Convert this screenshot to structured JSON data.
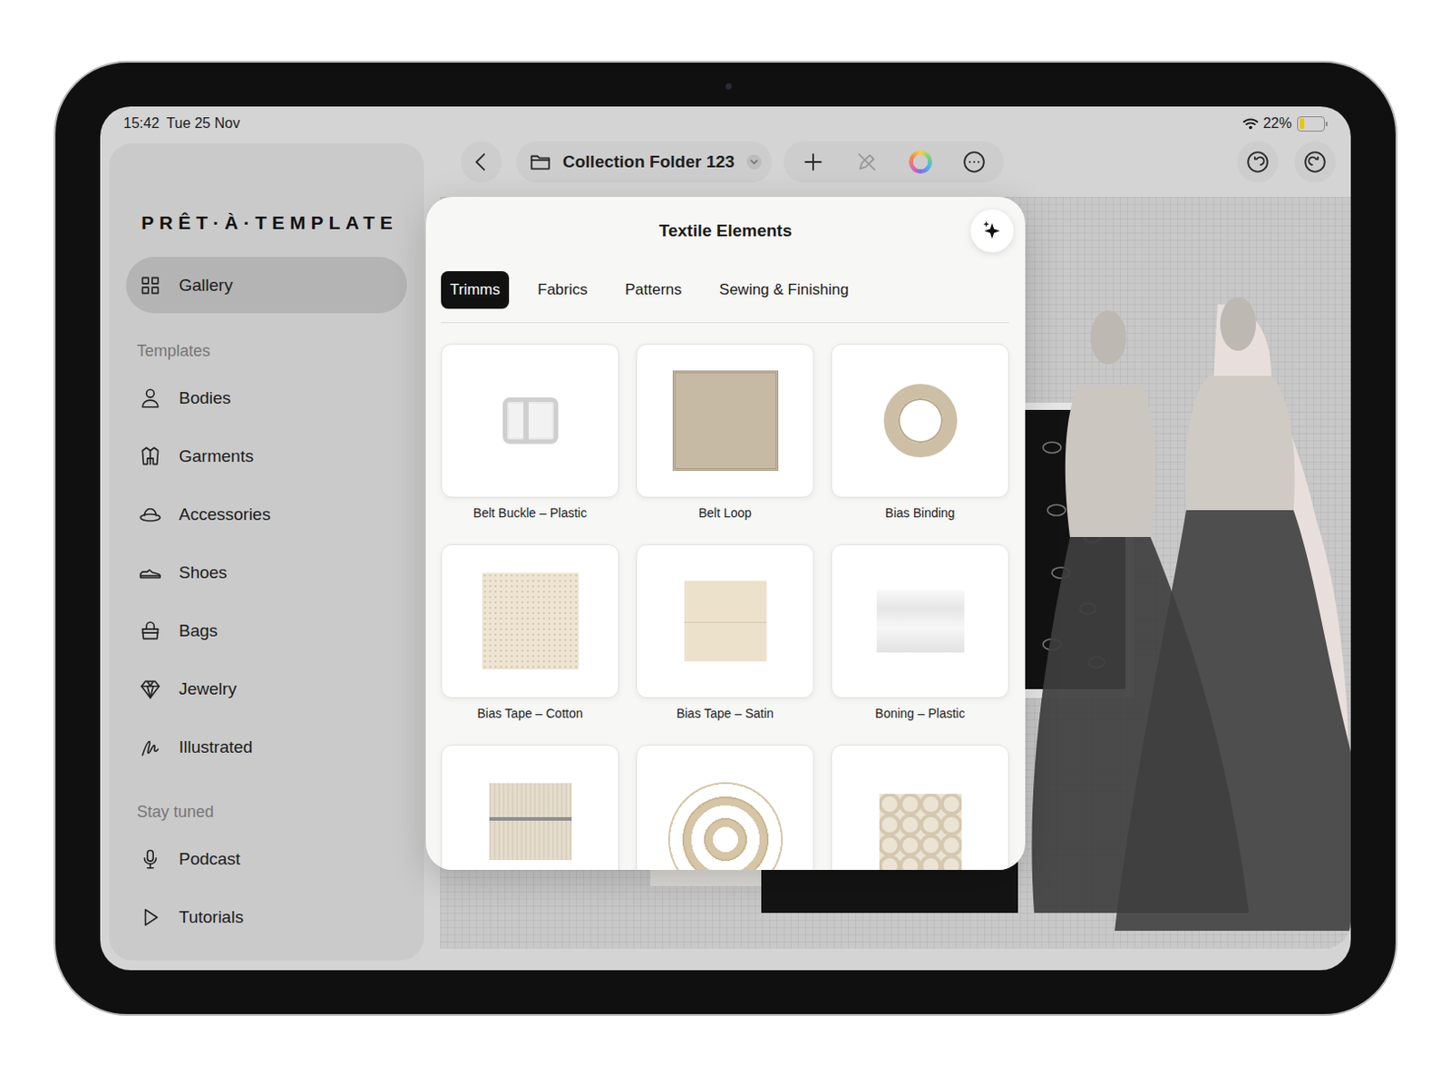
{
  "status_bar": {
    "time": "15:42",
    "date": "Tue 25 Nov",
    "battery": "22%",
    "battery_level": 0.22
  },
  "sidebar": {
    "logo": "PRÊT·À·TEMPLATE",
    "top_items": [
      {
        "label": "Gallery",
        "selected": true
      }
    ],
    "sections": [
      {
        "title": "Templates",
        "items": [
          {
            "label": "Bodies",
            "selected": false
          },
          {
            "label": "Garments",
            "selected": false
          },
          {
            "label": "Accessories",
            "selected": false
          },
          {
            "label": "Shoes",
            "selected": false
          },
          {
            "label": "Bags",
            "selected": false
          },
          {
            "label": "Jewelry",
            "selected": false
          },
          {
            "label": "Illustrated",
            "selected": false
          }
        ]
      },
      {
        "title": "Stay tuned",
        "items": [
          {
            "label": "Podcast",
            "selected": false
          },
          {
            "label": "Tutorials",
            "selected": false
          }
        ]
      }
    ]
  },
  "toolbar": {
    "folder_title": "Collection Folder 123"
  },
  "popover": {
    "title": "Textile Elements",
    "tabs": [
      {
        "label": "Trimms",
        "selected": true
      },
      {
        "label": "Fabrics",
        "selected": false
      },
      {
        "label": "Patterns",
        "selected": false
      },
      {
        "label": "Sewing & Finishing",
        "selected": false
      }
    ],
    "items": [
      {
        "label": "Belt Buckle – Plastic"
      },
      {
        "label": "Belt Loop"
      },
      {
        "label": "Bias Binding"
      },
      {
        "label": "Bias Tape – Cotton"
      },
      {
        "label": "Bias Tape – Satin"
      },
      {
        "label": "Boning – Plastic"
      },
      {
        "label": ""
      },
      {
        "label": ""
      },
      {
        "label": ""
      }
    ]
  }
}
